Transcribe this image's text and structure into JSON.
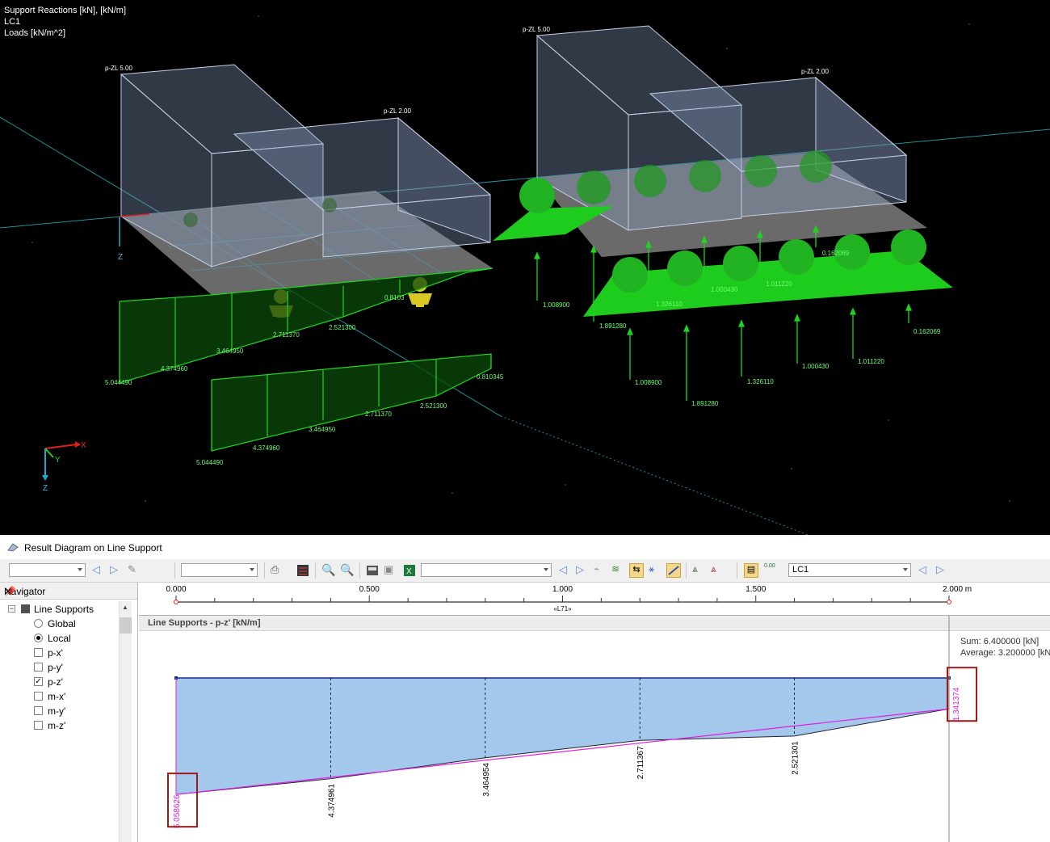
{
  "viewport": {
    "header_lines": [
      "Support Reactions [kN], [kN/m]",
      "LC1",
      "Loads [kN/m^2]"
    ],
    "load_labels_left": [
      "p-ZL 5.00",
      "p-ZL 2.00"
    ],
    "load_labels_right": [
      "p-ZL 5.00",
      "p-ZL 2.00"
    ],
    "line_diagram_labels": [
      "5.044490",
      "4.374960",
      "3.464950",
      "2.711370",
      "2.521300",
      "0.810345"
    ],
    "line_diagram_labels_upper": [
      "5.044490",
      "4.374960",
      "3.464950",
      "2.711370",
      "2.521300",
      "0.8103"
    ],
    "nodal_labels_front": [
      "1.008900",
      "1.891280",
      "1.326110",
      "1.000430",
      "1.011220",
      "0.162069"
    ],
    "nodal_labels_back": [
      "1.008900",
      "1.891280",
      "1.326110",
      "1.000430",
      "1.011220",
      "0.162069"
    ],
    "axes": {
      "x": "X",
      "y": "Y",
      "z": "Z"
    }
  },
  "panel": {
    "title": "Result Diagram on Line Support"
  },
  "toolbar": {
    "load_case": "LC1"
  },
  "navigator": {
    "title": "Navigator",
    "root": "Line Supports",
    "items": [
      {
        "label": "Global",
        "kind": "radio",
        "checked": false
      },
      {
        "label": "Local",
        "kind": "radio",
        "checked": true
      },
      {
        "label": "p-x'",
        "kind": "check",
        "checked": false
      },
      {
        "label": "p-y'",
        "kind": "check",
        "checked": false
      },
      {
        "label": "p-z'",
        "kind": "check",
        "checked": true
      },
      {
        "label": "m-x'",
        "kind": "check",
        "checked": false
      },
      {
        "label": "m-y'",
        "kind": "check",
        "checked": false
      },
      {
        "label": "m-z'",
        "kind": "check",
        "checked": false
      }
    ]
  },
  "ruler": {
    "ticks": [
      "0.000",
      "0.500",
      "1.000",
      "1.500",
      "2.000 m"
    ],
    "line_label": "«L71»"
  },
  "diagram": {
    "title": "Line Supports - p-z' [kN/m]",
    "sum": "Sum: 6.400000 [kN]",
    "average": "Average: 3.200000 [kN"
  },
  "chart_data": {
    "type": "area",
    "title": "Line Supports - p-z' [kN/m]",
    "xlabel": "m",
    "x": [
      0.0,
      0.4,
      0.8,
      1.2,
      1.6,
      2.0
    ],
    "xlim": [
      0,
      2
    ],
    "series": [
      {
        "values": [
          5.058626,
          4.374961,
          3.464954,
          2.711367,
          2.521301,
          1.341374
        ]
      }
    ],
    "value_labels": [
      "5.058626",
      "4.374961",
      "3.464954",
      "2.711367",
      "2.521301",
      "1.341374"
    ],
    "highlighted_labels": [
      "5.058626",
      "1.341374"
    ],
    "colors": {
      "fill": "#a4c8ec",
      "trend": "#e020e0",
      "outline": "#1a2a8a"
    }
  }
}
